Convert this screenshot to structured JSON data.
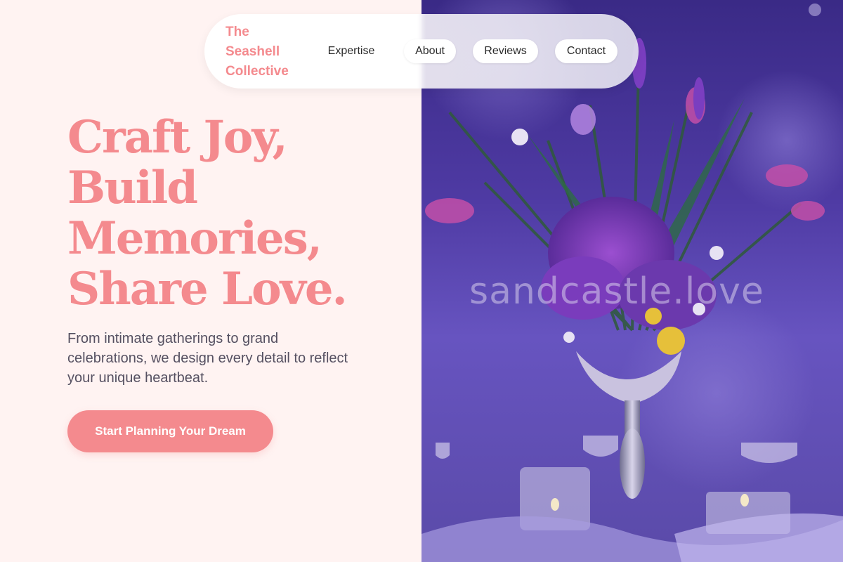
{
  "brand": {
    "name": "The Seashell Collective"
  },
  "nav": {
    "links": [
      {
        "label": "Expertise"
      },
      {
        "label": "About"
      },
      {
        "label": "Reviews"
      },
      {
        "label": "Contact"
      }
    ]
  },
  "hero": {
    "headline_lines": [
      "Craft Joy,",
      "Build",
      "Memories,",
      "Share Love."
    ],
    "subtext": "From intimate gatherings to grand celebrations, we design every detail to reflect your unique heartbeat.",
    "cta_label": "Start Planning Your Dream",
    "watermark": "sandcastle.love"
  },
  "colors": {
    "accent": "#f48a8e",
    "background": "#fff3f2",
    "text": "#555061",
    "photo_tint": "#4e3aa3"
  },
  "icons": []
}
